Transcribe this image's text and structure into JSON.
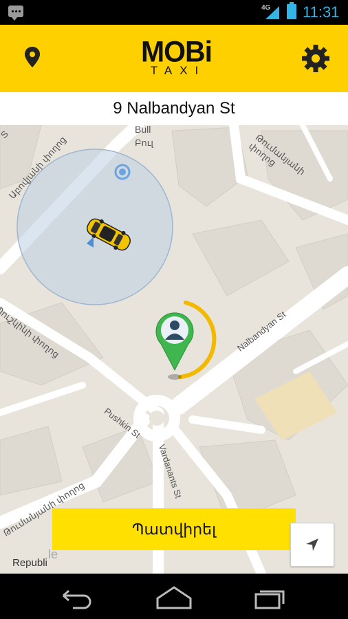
{
  "status_bar": {
    "network": "4G",
    "time": "11:31"
  },
  "header": {
    "logo_main": "MOBi",
    "logo_sub": "TAXI",
    "accent_color": "#ffd000"
  },
  "address": {
    "value": "9 Nalbandyan St"
  },
  "map": {
    "labels": {
      "bull": "Bull",
      "bull_arm": "Բուլ",
      "abovyan": "Աբովյանի փողոց",
      "tumanyan_top": "Թումանյանի փողոց",
      "nalbandyan": "Nalbandyan St",
      "pushkin_arm": "Պուշկինի փողոց",
      "pushkin": "Pushkin St",
      "vardanants": "Vardanants St",
      "tumanyan_bottom": "Թումանյանի փողոց",
      "republic": "Republi",
      "s_top": "S",
      "map_corner": "le"
    },
    "taxi_icon": "taxi-car-icon",
    "user_pin_icon": "user-location-pin-icon"
  },
  "actions": {
    "order_label": "Պատվիրել"
  },
  "nav": {
    "back": "back-icon",
    "home": "home-icon",
    "recents": "recents-icon"
  }
}
